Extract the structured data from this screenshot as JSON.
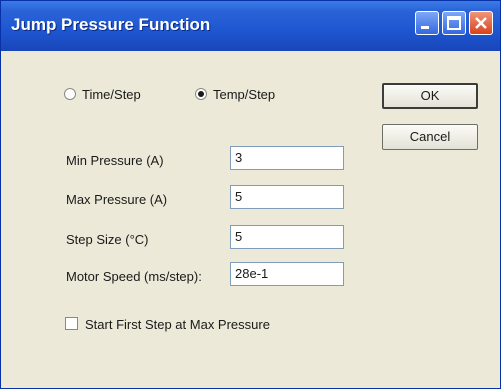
{
  "window": {
    "title": "Jump Pressure Function",
    "controls": {
      "minimize_icon": "minimize-icon",
      "maximize_icon": "maximize-icon",
      "close_icon": "close-icon"
    }
  },
  "mode": {
    "options": [
      {
        "label": "Time/Step",
        "selected": false
      },
      {
        "label": "Temp/Step",
        "selected": true
      }
    ]
  },
  "buttons": {
    "ok_label": "OK",
    "cancel_label": "Cancel"
  },
  "fields": [
    {
      "label": "Min Pressure (A)",
      "value": "3"
    },
    {
      "label": "Max Pressure (A)",
      "value": "5"
    },
    {
      "label": "Step Size (°C)",
      "value": "5"
    },
    {
      "label": "Motor Speed (ms/step):",
      "value": "28e-1"
    }
  ],
  "options": {
    "start_first_step_label": "Start First Step at Max Pressure",
    "start_first_step_checked": false
  }
}
